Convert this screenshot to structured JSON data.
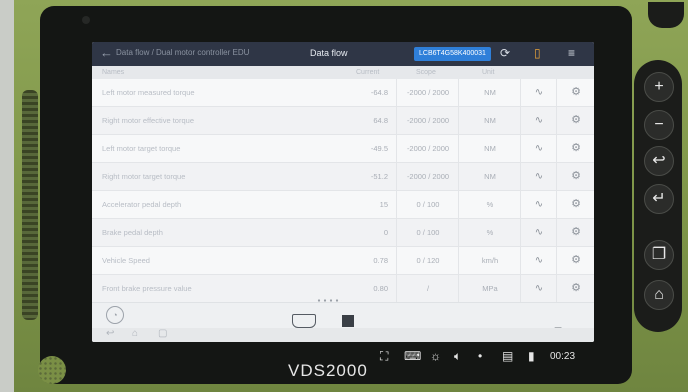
{
  "device": {
    "brand": "VDS2000",
    "clock": "00:23"
  },
  "app": {
    "title": "Data flow",
    "vin": "LCB6T4G58K400031",
    "breadcrumb": "Data flow / Dual motor controller EDU"
  },
  "table": {
    "columns": [
      "Names",
      "Current",
      "Scope",
      "Unit"
    ],
    "rows": [
      {
        "name": "Left motor measured torque",
        "current": "-64.8",
        "scope": "-2000 / 2000",
        "unit": "NM"
      },
      {
        "name": "Right motor effective torque",
        "current": "64.8",
        "scope": "-2000 / 2000",
        "unit": "NM"
      },
      {
        "name": "Left motor target torque",
        "current": "-49.5",
        "scope": "-2000 / 2000",
        "unit": "NM"
      },
      {
        "name": "Right motor target torque",
        "current": "-51.2",
        "scope": "-2000 / 2000",
        "unit": "NM"
      },
      {
        "name": "Accelerator pedal depth",
        "current": "15",
        "scope": "0 / 100",
        "unit": "%"
      },
      {
        "name": "Brake pedal depth",
        "current": "0",
        "scope": "0 / 100",
        "unit": "%"
      },
      {
        "name": "Vehicle Speed",
        "current": "0.78",
        "scope": "0 / 120",
        "unit": "km/h"
      },
      {
        "name": "Front brake pressure value",
        "current": "0.80",
        "scope": "/",
        "unit": "MPa"
      }
    ]
  },
  "icons": {
    "wave": "∿",
    "gear": "⚙",
    "refresh": "⟳",
    "report": "▯",
    "menu": "≡",
    "back": "←"
  },
  "hardware_buttons": [
    "+",
    "−",
    "↩",
    "↵",
    "❐",
    "⌂"
  ],
  "colors": {
    "frame": "#8fa557",
    "topbar": "#2f3646",
    "vin_badge": "#2f7fd9"
  }
}
